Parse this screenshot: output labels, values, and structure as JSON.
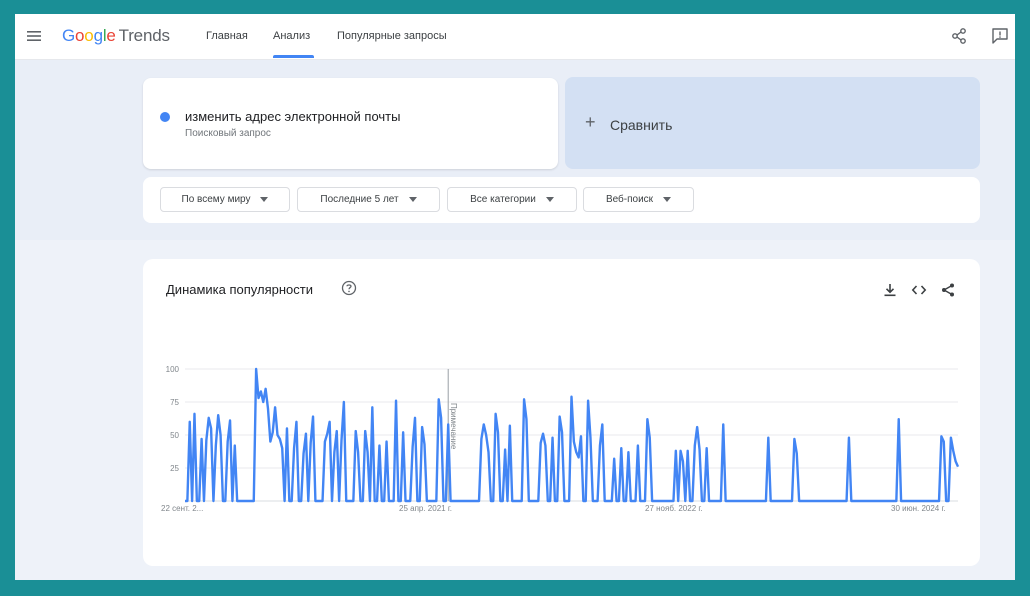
{
  "header": {
    "logo": {
      "g1": "G",
      "o1": "o",
      "o2": "o",
      "g2": "g",
      "l": "l",
      "e": "e",
      "trends": "Trends"
    },
    "nav": [
      {
        "label": "Главная"
      },
      {
        "label": "Анализ"
      },
      {
        "label": "Популярные запросы"
      }
    ],
    "active_nav": "Анализ"
  },
  "query": {
    "term": "изменить адрес электронной почты",
    "type": "Поисковый запрос",
    "color": "#4285f4"
  },
  "compare": {
    "plus": "+",
    "label": "Сравнить"
  },
  "filters": [
    {
      "label": "По всему миру"
    },
    {
      "label": "Последние 5 лет"
    },
    {
      "label": "Все категории"
    },
    {
      "label": "Веб-поиск"
    }
  ],
  "chart_card": {
    "title": "Динамика популярности"
  },
  "chart_data": {
    "type": "line",
    "series_color": "#4285f4",
    "y_ticks": [
      "100",
      "75",
      "50",
      "25"
    ],
    "ylim": [
      0,
      100
    ],
    "x_tick_labels": [
      "22 сент. 2...",
      "25 апр. 2021 г.",
      "27 нояб. 2022 г.",
      "30 июн. 2024 г."
    ],
    "annotation": {
      "label": "Примечание",
      "index": 111
    },
    "values": [
      0,
      0,
      60,
      0,
      66,
      0,
      0,
      47,
      0,
      46,
      63,
      55,
      0,
      42,
      65,
      50,
      0,
      0,
      45,
      61,
      0,
      42,
      0,
      0,
      0,
      0,
      0,
      0,
      0,
      0,
      100,
      78,
      83,
      75,
      85,
      70,
      45,
      52,
      71,
      50,
      47,
      40,
      0,
      55,
      0,
      0,
      40,
      60,
      0,
      0,
      36,
      51,
      0,
      44,
      64,
      0,
      0,
      0,
      0,
      45,
      51,
      60,
      0,
      37,
      53,
      0,
      46,
      75,
      0,
      0,
      0,
      0,
      53,
      37,
      0,
      0,
      53,
      37,
      0,
      71,
      0,
      0,
      42,
      0,
      0,
      45,
      0,
      0,
      0,
      76,
      0,
      0,
      52,
      0,
      0,
      0,
      41,
      63,
      0,
      0,
      56,
      43,
      0,
      0,
      0,
      0,
      0,
      77,
      63,
      0,
      0,
      58,
      0,
      0,
      0,
      0,
      0,
      0,
      0,
      0,
      0,
      0,
      0,
      0,
      0,
      47,
      58,
      50,
      37,
      0,
      0,
      66,
      52,
      0,
      0,
      39,
      0,
      57,
      0,
      0,
      0,
      0,
      0,
      77,
      62,
      0,
      0,
      0,
      0,
      0,
      44,
      51,
      42,
      0,
      0,
      48,
      0,
      0,
      64,
      52,
      0,
      0,
      0,
      79,
      45,
      37,
      33,
      49,
      0,
      0,
      76,
      48,
      0,
      0,
      0,
      42,
      58,
      0,
      0,
      0,
      0,
      32,
      0,
      0,
      40,
      0,
      0,
      37,
      0,
      0,
      0,
      42,
      0,
      0,
      0,
      62,
      48,
      0,
      0,
      0,
      0,
      0,
      0,
      0,
      0,
      0,
      0,
      38,
      0,
      38,
      30,
      0,
      38,
      0,
      0,
      42,
      56,
      39,
      0,
      0,
      40,
      0,
      0,
      0,
      0,
      0,
      0,
      58,
      0,
      0,
      0,
      0,
      0,
      0,
      0,
      0,
      0,
      0,
      0,
      0,
      0,
      0,
      0,
      0,
      0,
      0,
      48,
      0,
      0,
      0,
      0,
      0,
      0,
      0,
      0,
      0,
      0,
      47,
      36,
      0,
      0,
      0,
      0,
      0,
      0,
      0,
      0,
      0,
      0,
      0,
      0,
      0,
      0,
      0,
      0,
      0,
      0,
      0,
      0,
      0,
      48,
      0,
      0,
      0,
      0,
      0,
      0,
      0,
      0,
      0,
      0,
      0,
      0,
      0,
      0,
      0,
      0,
      0,
      0,
      0,
      0,
      62,
      0,
      0,
      0,
      0,
      0,
      0,
      0,
      0,
      0,
      0,
      0,
      0,
      0,
      0,
      0,
      0,
      0,
      49,
      45,
      0,
      0,
      48,
      38,
      30,
      26
    ]
  }
}
